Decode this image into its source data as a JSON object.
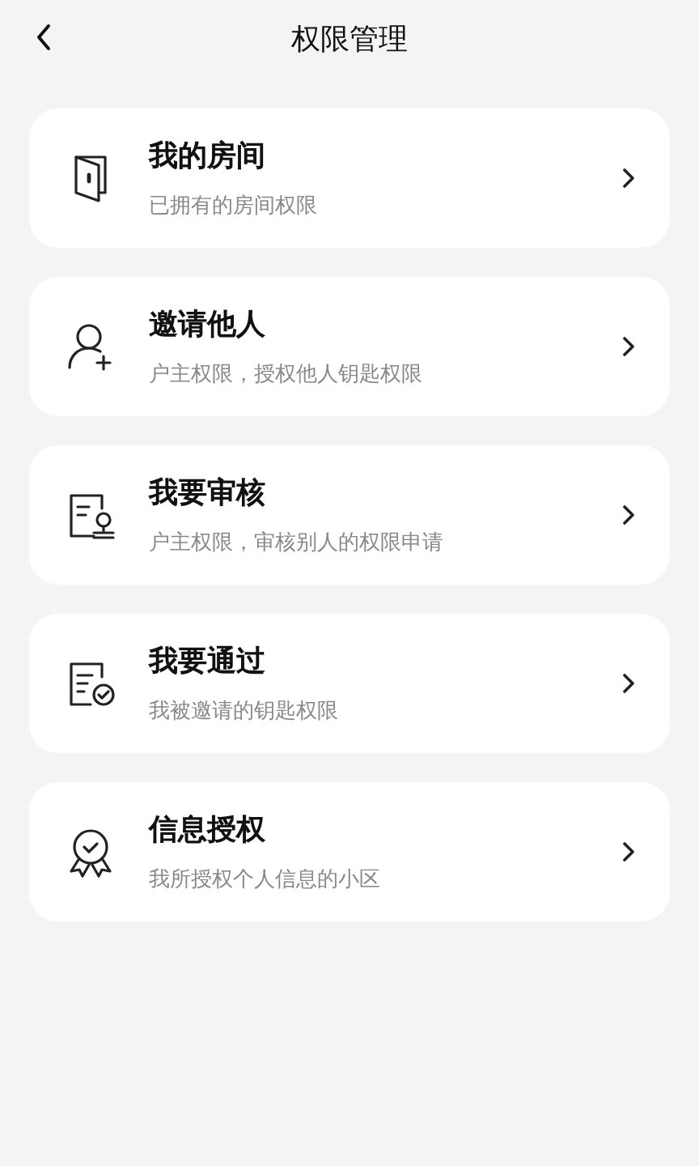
{
  "header": {
    "title": "权限管理"
  },
  "items": [
    {
      "kind": "door",
      "title": "我的房间",
      "subtitle": "已拥有的房间权限"
    },
    {
      "kind": "person-add",
      "title": "邀请他人",
      "subtitle": "户主权限，授权他人钥匙权限"
    },
    {
      "kind": "review",
      "title": "我要审核",
      "subtitle": "户主权限，审核别人的权限申请"
    },
    {
      "kind": "approved",
      "title": "我要通过",
      "subtitle": "我被邀请的钥匙权限"
    },
    {
      "kind": "badge",
      "title": "信息授权",
      "subtitle": "我所授权个人信息的小区"
    }
  ]
}
